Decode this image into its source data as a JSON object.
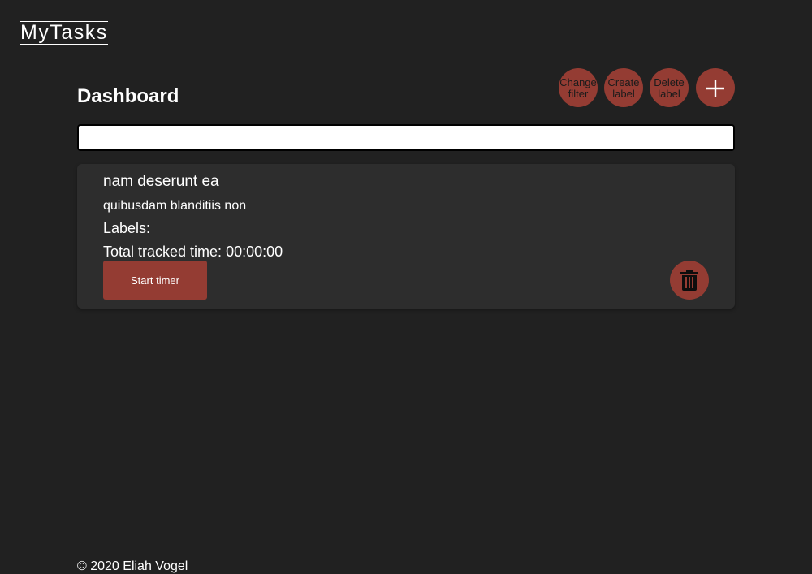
{
  "app": {
    "title": "MyTasks"
  },
  "page": {
    "title": "Dashboard"
  },
  "actions": {
    "change_filter_label": "Change filter",
    "create_label_label": "Create label",
    "delete_label_label": "Delete label",
    "add_icon": "plus-icon"
  },
  "search": {
    "value": "",
    "placeholder": ""
  },
  "tasks": [
    {
      "title": "nam deserunt ea",
      "description": "quibusdam blanditiis non",
      "labels_caption": "Labels:",
      "tracked_time_caption": "Total tracked time:",
      "tracked_time_value": "00:00:00",
      "start_timer_label": "Start timer",
      "delete_icon": "trash-icon"
    }
  ],
  "footer": {
    "text": "© 2020 Eliah Vogel"
  },
  "colors": {
    "background": "#212121",
    "card": "#2d2d2d",
    "accent": "#943c33",
    "text": "#ffffff"
  }
}
